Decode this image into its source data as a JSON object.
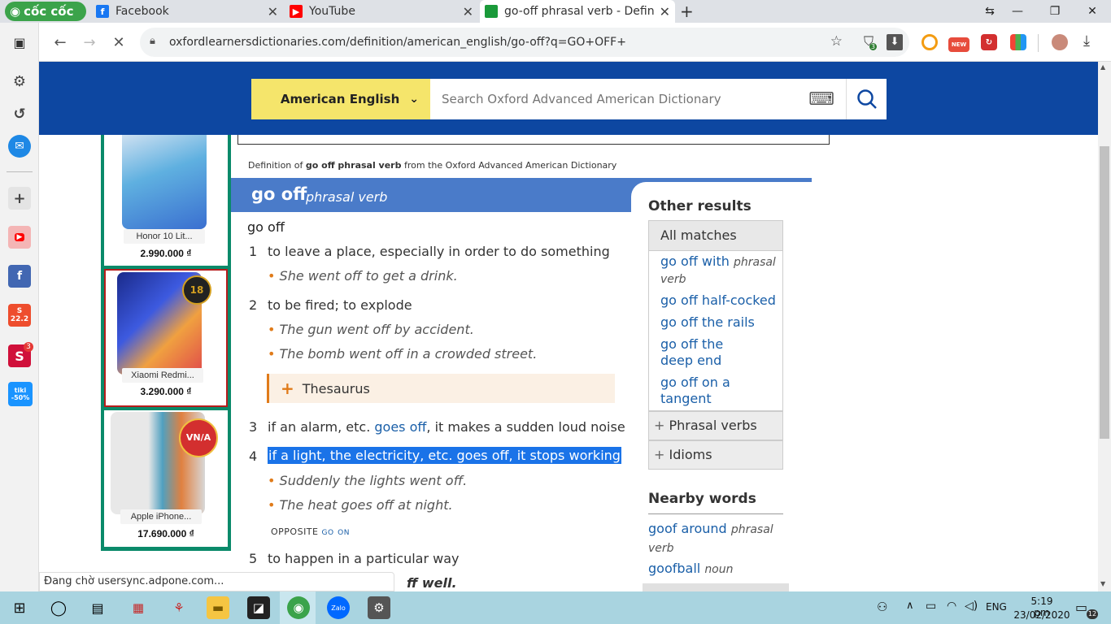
{
  "browser": {
    "logo": "cốc cốc",
    "tabs": [
      {
        "title": "Facebook",
        "icon": "facebook-icon",
        "color": "#1877f2"
      },
      {
        "title": "YouTube",
        "icon": "youtube-icon",
        "color": "#ff0000"
      },
      {
        "title": "go-off phrasal verb - Definitio",
        "icon": "oxford-icon",
        "color": "#1a9a3a"
      }
    ],
    "url": "oxfordlearnersdictionaries.com/definition/american_english/go-off?q=GO+OFF+",
    "ext_new_badge": "NEW",
    "ext_shield_count": "3",
    "sidebar_badge": "3",
    "sidebar_shopee": "22.2",
    "sidebar_tiki": "tiki -50%"
  },
  "search": {
    "language": "American English",
    "placeholder": "Search Oxford Advanced American Dictionary"
  },
  "ads": [
    {
      "name": "Honor 10 Lit...",
      "price": "2.990.000 ₫"
    },
    {
      "name": "Xiaomi Redmi...",
      "price": "3.290.000 ₫"
    },
    {
      "name": "Apple iPhone...",
      "price": "17.690.000 ₫"
    }
  ],
  "entry": {
    "source_prefix": "Definition of ",
    "source_term": "go off phrasal verb",
    "source_suffix": " from the Oxford Advanced American Dictionary",
    "headword": "go off",
    "pos": "phrasal verb",
    "subhead": "go off",
    "senses": [
      {
        "num": "1",
        "def": "to leave a place, especially in order to do something",
        "examples": [
          "She went off to get a drink."
        ]
      },
      {
        "num": "2",
        "def": "to be fired; to explode",
        "examples": [
          "The gun went off by accident.",
          "The bomb went off in a crowded street."
        ]
      },
      {
        "num": "3",
        "def_before": "if an alarm, etc. ",
        "def_link": "goes off",
        "def_after": ", it makes a sudden loud noise"
      },
      {
        "num": "4",
        "def": "if a light, the electricity, etc. goes off, it stops working",
        "examples": [
          "Suddenly the lights went off.",
          "The heat goes off at night."
        ],
        "opposite_label": "OPPOSITE",
        "opposite_word": "go on"
      },
      {
        "num": "5",
        "def": "to happen in a particular way",
        "partial_example": "ff well."
      }
    ],
    "thesaurus": "Thesaurus"
  },
  "other_results": {
    "title": "Other results",
    "all_matches": "All matches",
    "matches": [
      {
        "term": "go off with",
        "pos": "phrasal verb"
      },
      {
        "term": "go off half-cocked",
        "pos": ""
      },
      {
        "term": "go off the rails",
        "pos": ""
      },
      {
        "term": "go off the deep end",
        "pos": ""
      },
      {
        "term": "go off on a tangent",
        "pos": ""
      }
    ],
    "phrasal_verbs": "Phrasal verbs",
    "idioms": "Idioms"
  },
  "nearby": {
    "title": "Nearby words",
    "items": [
      {
        "term": "goof around",
        "pos": "phrasal verb"
      },
      {
        "term": "goofball",
        "pos": "noun"
      }
    ]
  },
  "status_text": "Đang chờ usersync.adpone.com...",
  "taskbar": {
    "lang": "ENG",
    "time": "5:19 pm",
    "date": "23/02/2020",
    "notif_count": "12"
  }
}
